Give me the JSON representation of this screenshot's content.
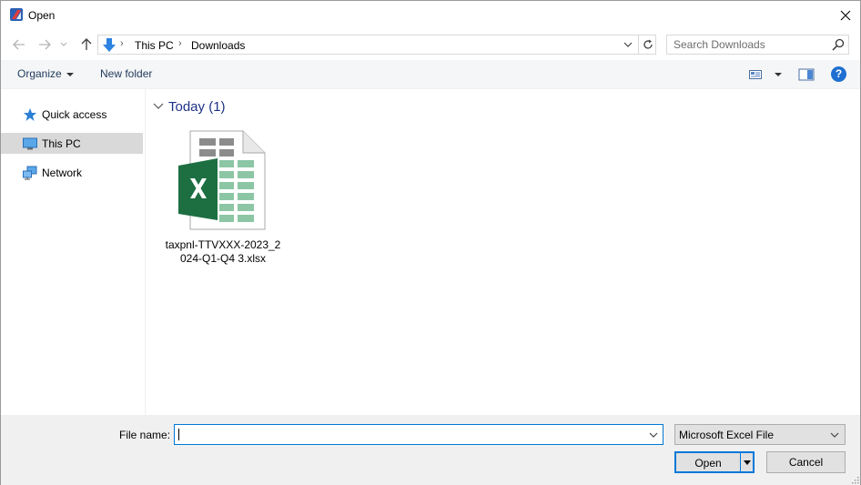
{
  "window": {
    "title": "Open"
  },
  "nav": {
    "breadcrumbs": [
      "This PC",
      "Downloads"
    ],
    "search_placeholder": "Search Downloads"
  },
  "commands": {
    "organize": "Organize",
    "new_folder": "New folder"
  },
  "sidebar": {
    "items": [
      {
        "label": "Quick access",
        "icon": "star-icon"
      },
      {
        "label": "This PC",
        "icon": "monitor-icon",
        "selected": true
      },
      {
        "label": "Network",
        "icon": "network-icon"
      }
    ]
  },
  "content": {
    "group_title": "Today (1)",
    "files": [
      {
        "name": "taxpnl-TTVXXX-2023_2024-Q1-Q4 3.xlsx",
        "icon": "excel-file-icon"
      }
    ]
  },
  "bottom": {
    "file_name_label": "File name:",
    "file_name_value": "",
    "file_type": "Microsoft Excel File",
    "open_label": "Open",
    "cancel_label": "Cancel"
  },
  "colors": {
    "accent": "#0078d7",
    "excel_green": "#1d6f42",
    "group_title": "#1e3287",
    "selection": "#d9d9d9"
  }
}
